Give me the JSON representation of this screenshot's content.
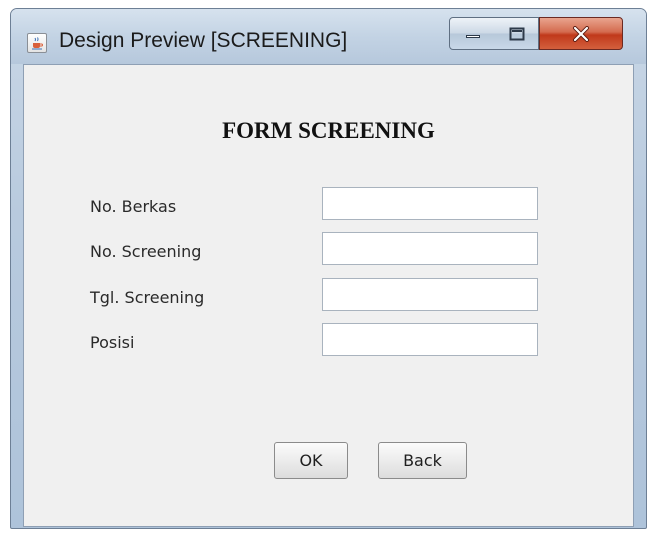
{
  "window": {
    "title": "Design Preview [SCREENING]",
    "icon": "java-cup-icon",
    "controls": [
      "minimize-icon",
      "maximize-icon",
      "close-icon"
    ]
  },
  "form": {
    "title": "FORM SCREENING",
    "fields": [
      {
        "label": "No. Berkas",
        "value": ""
      },
      {
        "label": "No. Screening",
        "value": ""
      },
      {
        "label": "Tgl. Screening",
        "value": ""
      },
      {
        "label": "Posisi",
        "value": ""
      }
    ]
  },
  "buttons": {
    "ok_label": "OK",
    "back_label": "Back"
  },
  "colors": {
    "titlebar": "#c3d3e4",
    "client_background": "#f0f0f0",
    "close_button": "#c0391b"
  }
}
